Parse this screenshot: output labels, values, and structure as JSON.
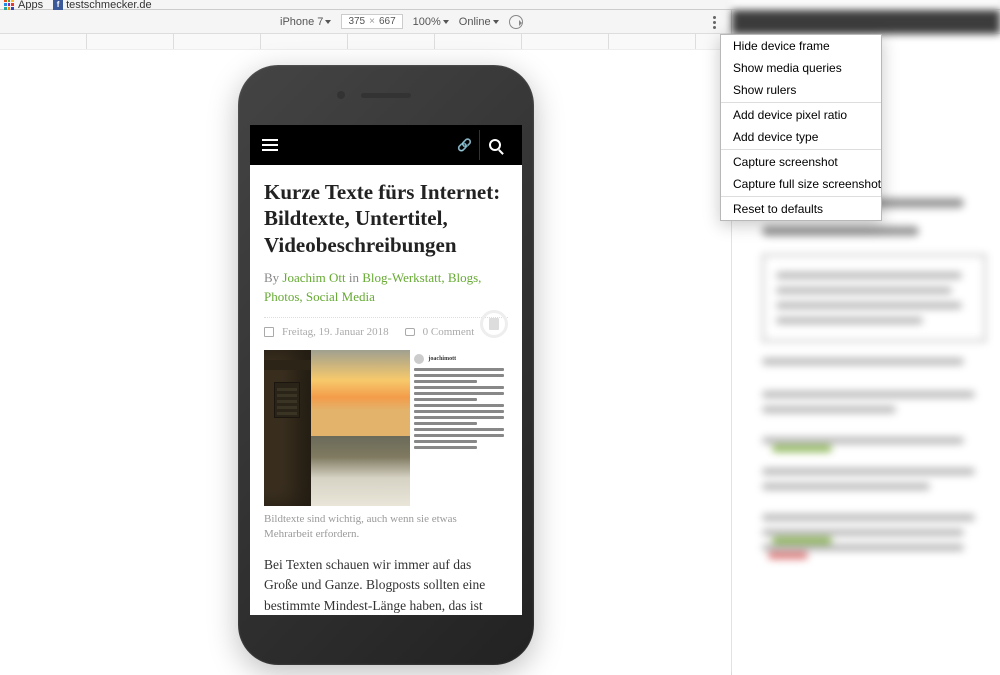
{
  "browser": {
    "apps_label": "Apps",
    "bookmarks": [
      {
        "label": "testschmecker.de",
        "icon": "facebook"
      }
    ]
  },
  "devtools": {
    "device": "iPhone 7",
    "width": "375",
    "height": "667",
    "zoom": "100%",
    "network": "Online",
    "menu": {
      "items": [
        "Hide device frame",
        "Show media queries",
        "Show rulers",
        "Add device pixel ratio",
        "Add device type",
        "Capture screenshot",
        "Capture full size screenshot",
        "Reset to defaults"
      ]
    }
  },
  "article": {
    "title": "Kurze Texte fürs Internet: Bildtexte, Untertitel, Videobeschreibungen",
    "by_label": "By ",
    "author": "Joachim Ott",
    "in_label": " in ",
    "categories": "Blog-Werkstatt, Blogs, Photos, Social Media",
    "date": "Freitag, 19. Januar 2018",
    "comments": "0 Comment",
    "insta_user": "joachimott",
    "caption": "Bildtexte sind wichtig, auch wenn sie etwas Mehrarbeit erfordern.",
    "body": "Bei Texten schauen wir immer auf das Große und Ganze. Blogposts sollten eine bestimmte Mindest-Länge haben, das ist suchmaschinenfreundlicher. Und was ist mit"
  }
}
